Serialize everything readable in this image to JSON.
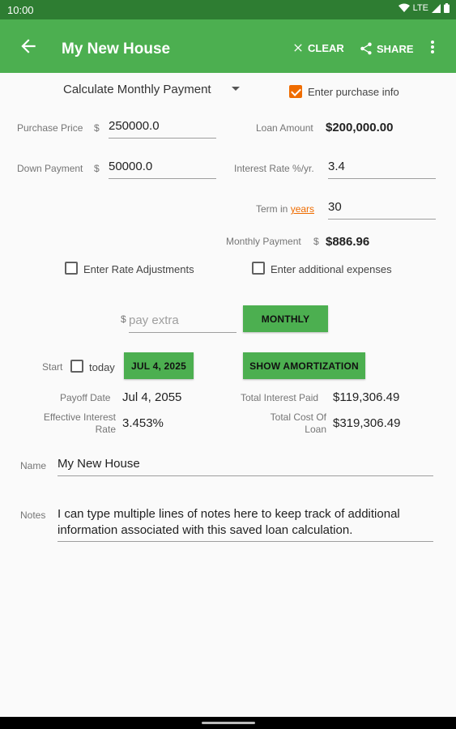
{
  "status_bar": {
    "time": "10:00",
    "network": "LTE"
  },
  "app_bar": {
    "title": "My New House",
    "clear_label": "CLEAR",
    "share_label": "SHARE"
  },
  "calc_mode": {
    "selected": "Calculate Monthly Payment"
  },
  "purchase_info": {
    "label": "Enter purchase info",
    "checked": true
  },
  "purchase_price": {
    "label": "Purchase Price",
    "currency": "$",
    "value": "250000.0"
  },
  "down_payment": {
    "label": "Down Payment",
    "currency": "$",
    "value": "50000.0"
  },
  "loan_amount": {
    "label": "Loan Amount",
    "value": "$200,000.00"
  },
  "interest_rate": {
    "label": "Interest Rate %/yr.",
    "value": "3.4"
  },
  "term": {
    "label_prefix": "Term in",
    "unit": "years",
    "value": "30"
  },
  "monthly_payment": {
    "label": "Monthly Payment",
    "currency": "$",
    "value": "$886.96"
  },
  "rate_adjustments": {
    "label": "Enter Rate Adjustments",
    "checked": false
  },
  "additional_expenses": {
    "label": "Enter additional expenses",
    "checked": false
  },
  "extra_payment": {
    "currency": "$",
    "placeholder": "pay extra",
    "frequency_label": "MONTHLY"
  },
  "start": {
    "label": "Start",
    "today_label": "today",
    "today_checked": false,
    "date_label": "JUL 4, 2025"
  },
  "amortization_button": "SHOW AMORTIZATION",
  "results": {
    "payoff_date_label": "Payoff Date",
    "payoff_date": "Jul 4, 2055",
    "total_interest_label": "Total Interest Paid",
    "total_interest": "$119,306.49",
    "effective_rate_label_1": "Effective Interest",
    "effective_rate_label_2": "Rate",
    "effective_rate": "3.453%",
    "total_cost_label_1": "Total Cost Of",
    "total_cost_label_2": "Loan",
    "total_cost": "$319,306.49"
  },
  "name": {
    "label": "Name",
    "value": "My New House"
  },
  "notes": {
    "label": "Notes",
    "value": "I can type multiple lines of notes here to keep track of additional information associated with this saved loan calculation."
  },
  "colors": {
    "app_bar": "#4caf50",
    "status_bar": "#2e7d32",
    "accent": "#ef6c00"
  }
}
